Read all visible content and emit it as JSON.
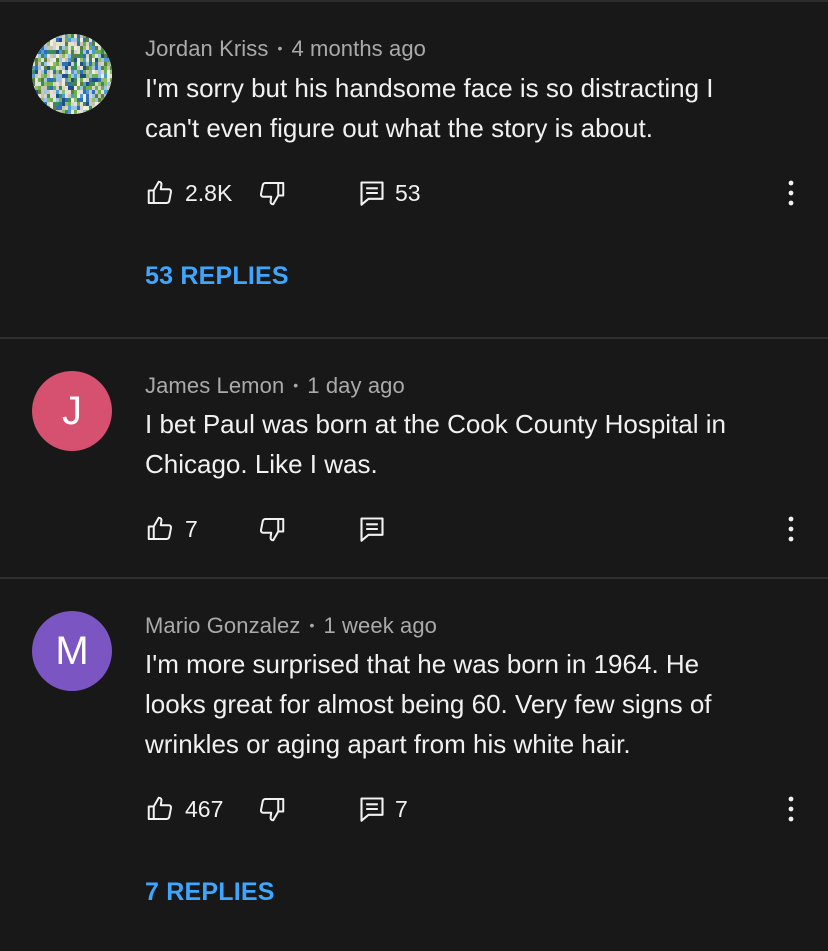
{
  "comments": [
    {
      "author": "Jordan Kriss",
      "separator": "•",
      "time": "4 months ago",
      "avatar": {
        "type": "image",
        "icon": "mosaic-avatar"
      },
      "text_lines": [
        "I'm sorry but his handsome face is so distracting I",
        "can't even figure out what the story is about."
      ],
      "likes": "2.8K",
      "reply_count": "53",
      "replies_label": "53 REPLIES"
    },
    {
      "author": "James Lemon",
      "separator": "•",
      "time": "1 day ago",
      "avatar": {
        "type": "letter",
        "letter": "J",
        "color": "#d6506f"
      },
      "text_lines": [
        "I bet Paul was born at the Cook County Hospital in",
        "Chicago. Like I was."
      ],
      "likes": "7",
      "reply_count": ""
    },
    {
      "author": "Mario Gonzalez",
      "separator": "•",
      "time": "1 week ago",
      "avatar": {
        "type": "letter",
        "letter": "M",
        "color": "#7b55c2"
      },
      "text_lines": [
        "I'm more surprised that he was born in 1964. He",
        "looks great for almost being 60. Very few signs of",
        "wrinkles or aging apart from his white hair."
      ],
      "likes": "467",
      "reply_count": "7",
      "replies_label": "7 REPLIES"
    }
  ],
  "icons": {
    "like": "thumbs-up-icon",
    "dislike": "thumbs-down-icon",
    "reply": "reply-comment-icon",
    "more": "more-vertical-icon"
  },
  "colors": {
    "background": "#181818",
    "text": "#f1f1f1",
    "meta": "#aaaaaa",
    "link": "#3ea6ff"
  }
}
